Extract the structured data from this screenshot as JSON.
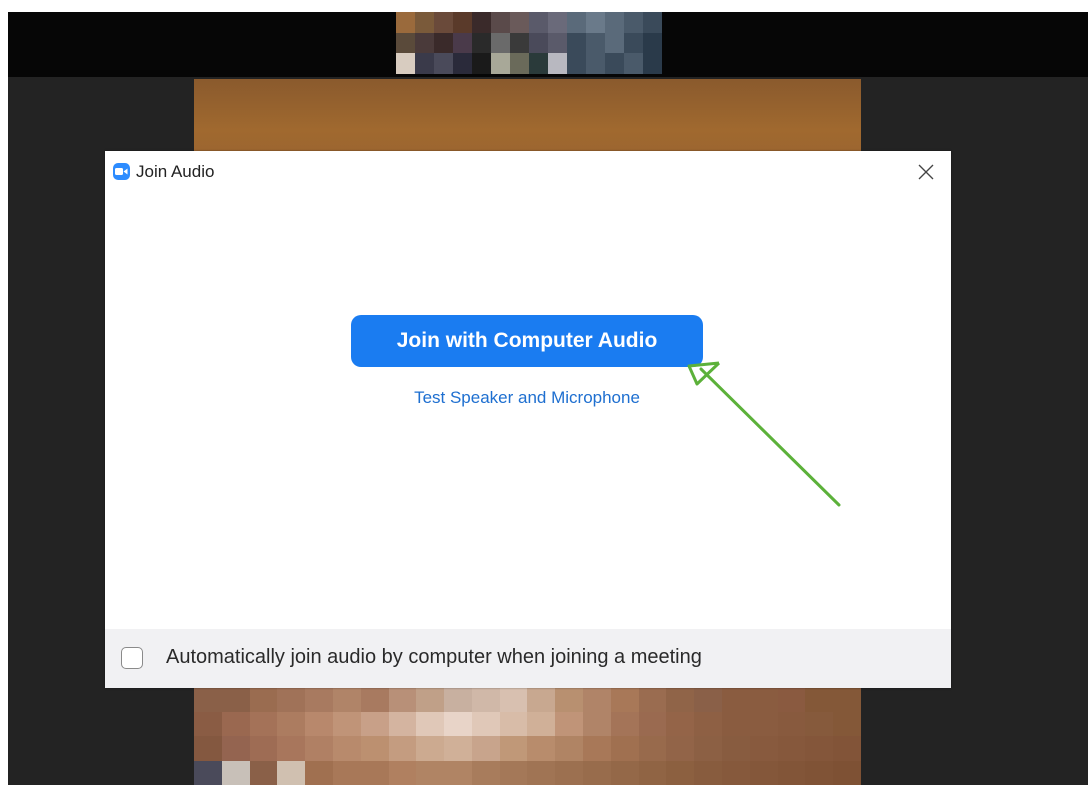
{
  "dialog": {
    "title": "Join Audio",
    "primary_button": "Join with Computer Audio",
    "test_link": "Test Speaker and Microphone",
    "auto_join_label": "Automatically join audio by computer when joining a meeting",
    "auto_join_checked": false
  },
  "colors": {
    "brand": "#2d8cff",
    "primary_button": "#1a7cf1",
    "link": "#1e6fd0",
    "annotation_arrow": "#5cb13a"
  },
  "icons": {
    "app": "zoom-camera-icon",
    "close": "close-icon",
    "annotation": "green-arrow-annotation"
  }
}
